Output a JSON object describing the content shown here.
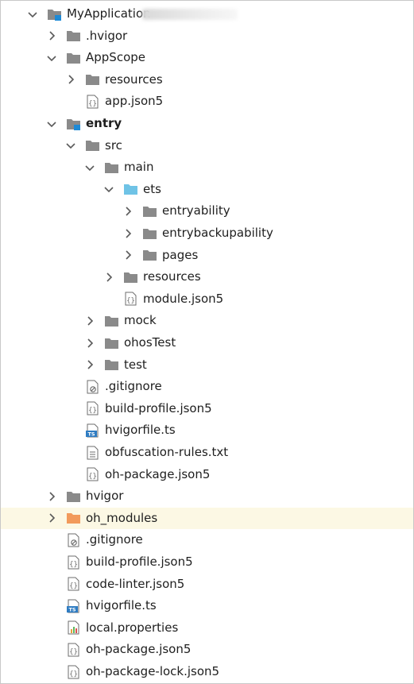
{
  "colors": {
    "folder": "#8a8a8a",
    "folder_blue": "#6fc3e6",
    "folder_orange": "#f29a5b",
    "module_accent": "#1e8ad6",
    "chevron": "#5a5a5a",
    "file_outline": "#6e6e6e",
    "ts_badge": "#2f7cc2",
    "highlight_row": "#fcf8e4"
  },
  "tree": [
    {
      "name": "project-root",
      "label": "MyApplication",
      "icon": "module-folder-icon",
      "chevron": "down",
      "depth": 0,
      "bold": false
    },
    {
      "name": "hvigor-dot-folder",
      "label": ".hvigor",
      "icon": "folder-icon",
      "chevron": "right",
      "depth": 1
    },
    {
      "name": "appscope-folder",
      "label": "AppScope",
      "icon": "folder-icon",
      "chevron": "down",
      "depth": 1
    },
    {
      "name": "appscope-resources-folder",
      "label": "resources",
      "icon": "folder-icon",
      "chevron": "right",
      "depth": 2
    },
    {
      "name": "appscope-app-json5",
      "label": "app.json5",
      "icon": "json-file-icon",
      "chevron": "none",
      "depth": 2
    },
    {
      "name": "entry-module",
      "label": "entry",
      "icon": "module-folder-icon",
      "chevron": "down",
      "depth": 1,
      "bold": true
    },
    {
      "name": "entry-src-folder",
      "label": "src",
      "icon": "folder-icon",
      "chevron": "down",
      "depth": 2
    },
    {
      "name": "entry-main-folder",
      "label": "main",
      "icon": "folder-icon",
      "chevron": "down",
      "depth": 3
    },
    {
      "name": "entry-ets-folder",
      "label": "ets",
      "icon": "source-folder-icon",
      "chevron": "down",
      "depth": 4
    },
    {
      "name": "entryability-folder",
      "label": "entryability",
      "icon": "folder-icon",
      "chevron": "right",
      "depth": 5
    },
    {
      "name": "entrybackupability-folder",
      "label": "entrybackupability",
      "icon": "folder-icon",
      "chevron": "right",
      "depth": 5
    },
    {
      "name": "pages-folder",
      "label": "pages",
      "icon": "folder-icon",
      "chevron": "right",
      "depth": 5
    },
    {
      "name": "main-resources-folder",
      "label": "resources",
      "icon": "folder-icon",
      "chevron": "right",
      "depth": 4
    },
    {
      "name": "module-json5-file",
      "label": "module.json5",
      "icon": "json-file-icon",
      "chevron": "none",
      "depth": 4
    },
    {
      "name": "mock-folder",
      "label": "mock",
      "icon": "folder-icon",
      "chevron": "right",
      "depth": 3
    },
    {
      "name": "ohostest-folder",
      "label": "ohosTest",
      "icon": "folder-icon",
      "chevron": "right",
      "depth": 3
    },
    {
      "name": "test-folder",
      "label": "test",
      "icon": "folder-icon",
      "chevron": "right",
      "depth": 3
    },
    {
      "name": "entry-gitignore-file",
      "label": ".gitignore",
      "icon": "gitignore-file-icon",
      "chevron": "none",
      "depth": 2
    },
    {
      "name": "entry-build-profile-file",
      "label": "build-profile.json5",
      "icon": "json-file-icon",
      "chevron": "none",
      "depth": 2
    },
    {
      "name": "entry-hvigorfile-ts",
      "label": "hvigorfile.ts",
      "icon": "ts-file-icon",
      "chevron": "none",
      "depth": 2
    },
    {
      "name": "obfuscation-rules-file",
      "label": "obfuscation-rules.txt",
      "icon": "text-file-icon",
      "chevron": "none",
      "depth": 2
    },
    {
      "name": "entry-oh-package-file",
      "label": "oh-package.json5",
      "icon": "json-file-icon",
      "chevron": "none",
      "depth": 2
    },
    {
      "name": "hvigor-folder",
      "label": "hvigor",
      "icon": "folder-icon",
      "chevron": "right",
      "depth": 1
    },
    {
      "name": "oh-modules-folder",
      "label": "oh_modules",
      "icon": "excluded-folder-icon",
      "chevron": "right",
      "depth": 1,
      "highlight": true
    },
    {
      "name": "root-gitignore-file",
      "label": ".gitignore",
      "icon": "gitignore-file-icon",
      "chevron": "none",
      "depth": 1
    },
    {
      "name": "root-build-profile-file",
      "label": "build-profile.json5",
      "icon": "json-file-icon",
      "chevron": "none",
      "depth": 1
    },
    {
      "name": "code-linter-file",
      "label": "code-linter.json5",
      "icon": "json-file-icon",
      "chevron": "none",
      "depth": 1
    },
    {
      "name": "root-hvigorfile-ts",
      "label": "hvigorfile.ts",
      "icon": "ts-file-icon",
      "chevron": "none",
      "depth": 1
    },
    {
      "name": "local-properties-file",
      "label": "local.properties",
      "icon": "properties-file-icon",
      "chevron": "none",
      "depth": 1
    },
    {
      "name": "root-oh-package-file",
      "label": "oh-package.json5",
      "icon": "json-file-icon",
      "chevron": "none",
      "depth": 1
    },
    {
      "name": "oh-package-lock-file",
      "label": "oh-package-lock.json5",
      "icon": "json-file-icon",
      "chevron": "none",
      "depth": 1
    }
  ]
}
